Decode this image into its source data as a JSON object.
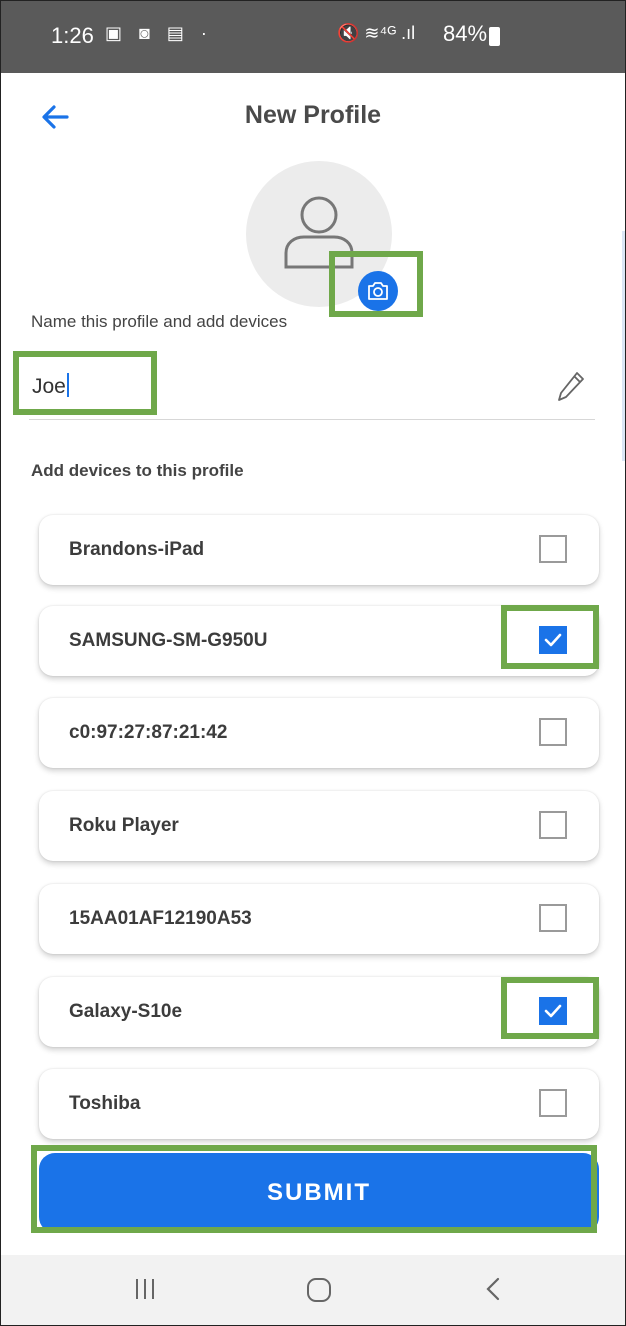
{
  "status_bar": {
    "time": "1:26",
    "left_icons": "▣ ◙ ▤ ·",
    "right_icons": "🔇 ≋⁴ᴳ .ıl",
    "battery": "84%"
  },
  "header": {
    "title": "New Profile",
    "back_icon": "arrow-left-icon"
  },
  "avatar": {
    "icon": "person-icon",
    "camera_icon": "camera-icon"
  },
  "form": {
    "hint": "Name this profile and add devices",
    "name_value": "Joe",
    "edit_icon": "pencil-icon",
    "devices_label": "Add devices to this profile"
  },
  "devices": [
    {
      "name": "Brandons-iPad",
      "checked": false
    },
    {
      "name": "SAMSUNG-SM-G950U",
      "checked": true
    },
    {
      "name": "c0:97:27:87:21:42",
      "checked": false
    },
    {
      "name": "Roku Player",
      "checked": false
    },
    {
      "name": "15AA01AF12190A53",
      "checked": false
    },
    {
      "name": "Galaxy-S10e",
      "checked": true
    },
    {
      "name": "Toshiba",
      "checked": false
    }
  ],
  "submit_label": "SUBMIT",
  "nav": {
    "recent": "recent-apps-icon",
    "home": "home-icon",
    "back": "back-icon"
  },
  "colors": {
    "accent": "#1a73e8",
    "highlight": "#6fa84a",
    "status_bar": "#5a5a5a"
  }
}
